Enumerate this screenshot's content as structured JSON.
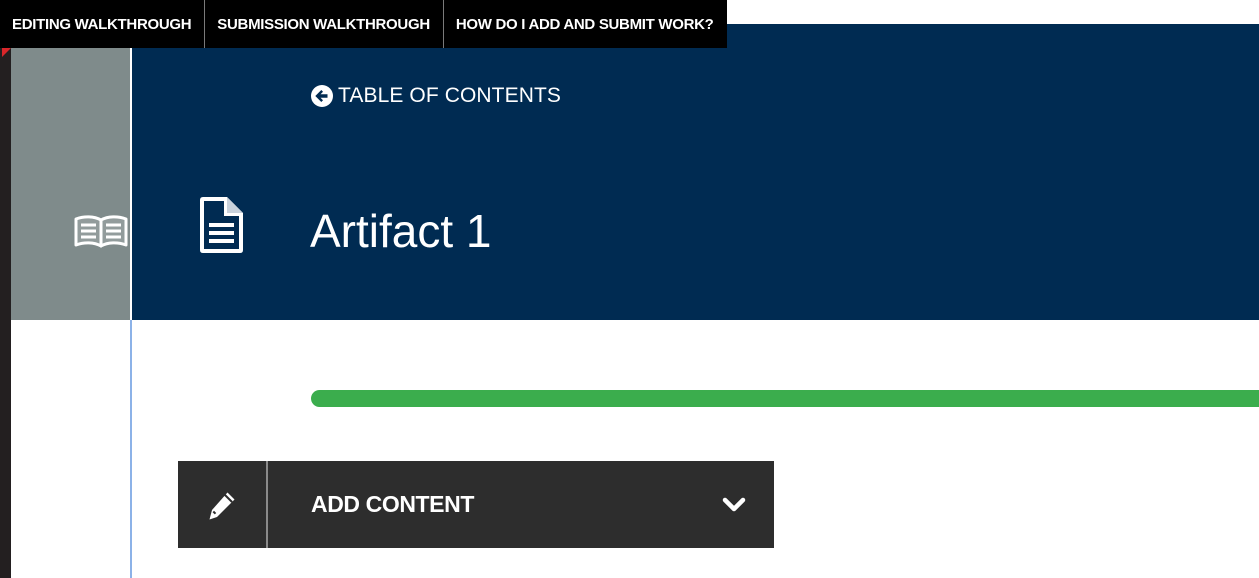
{
  "walkthrough_tabs": [
    {
      "label": "EDITING WALKTHROUGH"
    },
    {
      "label": "SUBMISSION WALKTHROUGH"
    },
    {
      "label": "HOW DO I ADD AND SUBMIT WORK?"
    }
  ],
  "header": {
    "toc_link_label": "TABLE OF CONTENTS",
    "title": "Artifact 1",
    "title_icon": "document-icon",
    "side_icon": "book-icon"
  },
  "progress": {
    "percent": 100,
    "color": "#3bad4d"
  },
  "content_toolbar": {
    "edit_icon": "pencil-icon",
    "add_content_label": "ADD CONTENT",
    "dropdown_icon": "chevron-down-icon"
  },
  "colors": {
    "header_bg": "#002b52",
    "side_column_bg": "#7f8b8b",
    "tab_bg": "#000000",
    "toolbar_bg": "#2d2d2d"
  }
}
